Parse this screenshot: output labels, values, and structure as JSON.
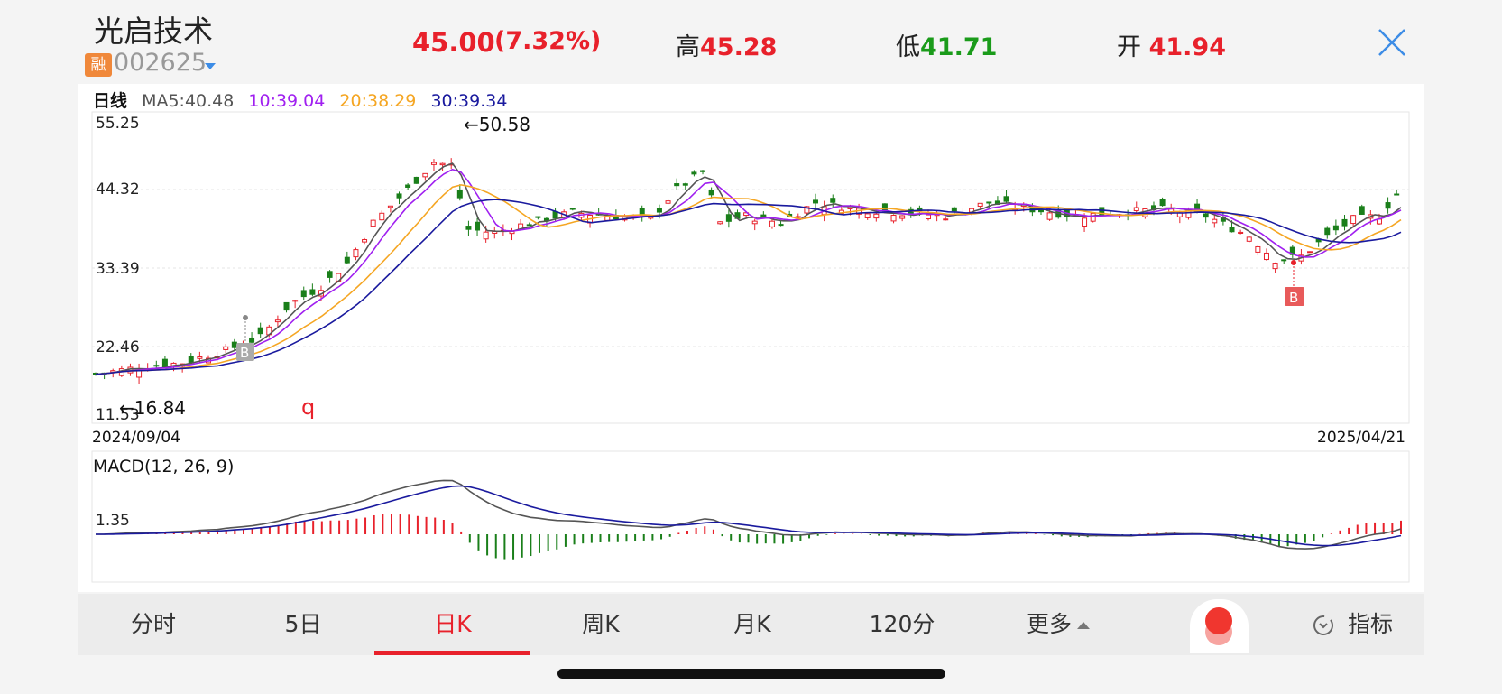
{
  "header": {
    "name": "光启技术",
    "badge": "融",
    "code": "002625",
    "price": "45.00",
    "change_pct": "(7.32%)",
    "high_label": "高",
    "high": "45.28",
    "low_label": "低",
    "low": "41.71",
    "open_label": "开",
    "open": "41.94"
  },
  "ma": {
    "period": "日线",
    "ma5": "MA5:40.48",
    "ma10": "10:39.04",
    "ma20": "20:38.29",
    "ma30": "30:39.34"
  },
  "colors": {
    "up": "#e8212b",
    "down": "#1a7f1a",
    "ma5": "#555555",
    "ma10": "#a020f0",
    "ma20": "#f5a623",
    "ma30": "#1a1a9e"
  },
  "chart": {
    "y_ticks": [
      "55.25",
      "44.32",
      "33.39",
      "22.46",
      "11.53"
    ],
    "max_label": "←50.58",
    "min_label": "←16.84",
    "start_date": "2024/09/04",
    "end_date": "2025/04/21",
    "marker_b": "B",
    "q_label": "q",
    "macd_title": "MACD(12, 26, 9)",
    "macd_tick": "1.35"
  },
  "tabs": [
    {
      "label": "分时"
    },
    {
      "label": "5日"
    },
    {
      "label": "日K"
    },
    {
      "label": "周K"
    },
    {
      "label": "月K"
    },
    {
      "label": "120分"
    },
    {
      "label": "更多"
    },
    {
      "label": "指标"
    }
  ],
  "active_tab": "日K"
}
